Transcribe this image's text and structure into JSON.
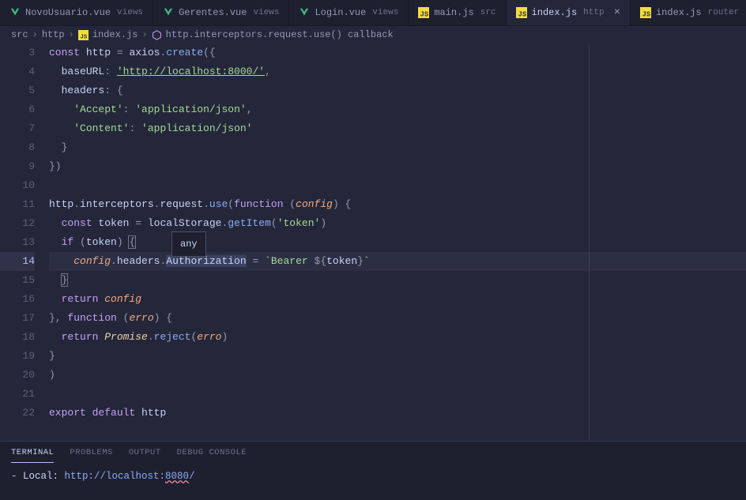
{
  "tabs": [
    {
      "icon": "vue",
      "name": "NovoUsuario.vue",
      "type": "views"
    },
    {
      "icon": "vue",
      "name": "Gerentes.vue",
      "type": "views"
    },
    {
      "icon": "vue",
      "name": "Login.vue",
      "type": "views"
    },
    {
      "icon": "js",
      "name": "main.js",
      "type": "src"
    },
    {
      "icon": "js",
      "name": "index.js",
      "type": "http",
      "active": true,
      "close": true
    },
    {
      "icon": "js",
      "name": "index.js",
      "type": "router"
    }
  ],
  "breadcrumbs": {
    "parts": [
      "src",
      "http",
      "index.js",
      "http.interceptors.request.use() callback"
    ]
  },
  "tooltip": "any",
  "lines": {
    "start": 3,
    "current": 14,
    "count": 20
  },
  "code": {
    "l3": {
      "kw": "const",
      "v1": "http",
      "eq": " = ",
      "v2": "axios",
      "dot": ".",
      "fn": "create",
      "p": "({"
    },
    "l4": {
      "prop": "baseURL",
      "colon": ": ",
      "str": "'http://localhost:8000/'",
      "comma": ","
    },
    "l5": {
      "prop": "headers",
      "colon": ": {"
    },
    "l6": {
      "str1": "'Accept'",
      "colon": ": ",
      "str2": "'application/json'",
      "comma": ","
    },
    "l7": {
      "str1": "'Content'",
      "colon": ": ",
      "str2": "'application/json'"
    },
    "l8": {
      "p": "}"
    },
    "l9": {
      "p": "})"
    },
    "l11_a": "http",
    "l11_b": ".",
    "l11_c": "interceptors",
    "l11_d": ".",
    "l11_e": "request",
    "l11_f": ".",
    "l11_g": "use",
    "l11_h": "(",
    "l11_i": "function",
    "l11_j": " (",
    "l11_k": "config",
    "l11_l": ") {",
    "l12_a": "const",
    "l12_b": " token ",
    "l12_c": "=",
    "l12_d": " localStorage",
    "l12_e": ".",
    "l12_f": "getItem",
    "l12_g": "(",
    "l12_h": "'token'",
    "l12_i": ")",
    "l13_a": "if",
    "l13_b": " (",
    "l13_c": "token",
    "l13_d": ") ",
    "l13_e": "{",
    "l14_a": "config",
    "l14_b": ".",
    "l14_c": "headers",
    "l14_d": ".",
    "l14_e": "Authorization",
    "l14_f": " = ",
    "l14_g": "`Bearer ",
    "l14_h": "${",
    "l14_i": "token",
    "l14_j": "}",
    "l14_k": "`",
    "l15": "}",
    "l16_a": "return",
    "l16_b": " config",
    "l17_a": "}, ",
    "l17_b": "function",
    "l17_c": " (",
    "l17_d": "erro",
    "l17_e": ") {",
    "l18_a": "return",
    "l18_b": " Promise",
    "l18_c": ".",
    "l18_d": "reject",
    "l18_e": "(",
    "l18_f": "erro",
    "l18_g": ")",
    "l19": "}",
    "l20": ")",
    "l22_a": "export",
    "l22_b": " default",
    "l22_c": " http"
  },
  "terminal": {
    "tabs": [
      "TERMINAL",
      "PROBLEMS",
      "OUTPUT",
      "DEBUG CONSOLE"
    ],
    "activeTab": 0,
    "line": {
      "prefix": "- Local:   ",
      "url_a": "http://localhost:",
      "url_b": "8080",
      "url_c": "/"
    }
  }
}
